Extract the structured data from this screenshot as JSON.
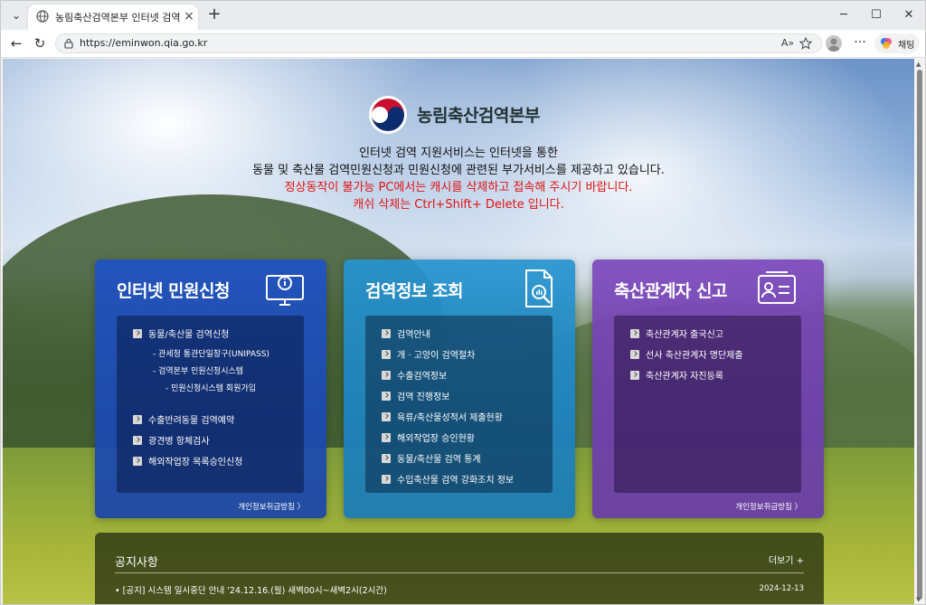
{
  "browser": {
    "tab_title": "농림축산검역본부 인터넷 검역지원",
    "new_tab": "+",
    "url": "https://eminwon.qia.go.kr",
    "copilot_label": "채팅",
    "minimize": "─",
    "maximize": "☐",
    "close": "✕",
    "read_aloud": "A»",
    "more": "···",
    "tab_close": "×",
    "back": "←",
    "refresh": "↻",
    "tab_list": "⌄"
  },
  "header": {
    "brand": "농림축산검역본부",
    "intro_line1": "인터넷 검역 지원서비스는 인터넷을 통한",
    "intro_line2": "동물 및 축산물 검역민원신청과 민원신청에 관련된 부가서비스를 제공하고 있습니다.",
    "warning_line1": "정상동작이 불가능 PC에서는 캐시를 삭제하고 접속해 주시기 바랍니다.",
    "warning_line2": "캐쉬 삭제는 Ctrl+Shift+ Delete 입니다."
  },
  "cards": [
    {
      "title": "인터넷 민원신청",
      "items": [
        "동물/축산물 검역신청",
        "수출반려동물 검역예약",
        "광견병 항체검사",
        "해외작업장 목록승인신청"
      ],
      "subitems": [
        "- 관세청 통관단일창구(UNIPASS)",
        "- 검역본부 민원신청시스템",
        "- 민원신청시스템 회원가입"
      ],
      "privacy": "개인정보취급방침 〉"
    },
    {
      "title": "검역정보 조회",
      "items": [
        "검역안내",
        "개 · 고양이 검역절차",
        "수출검역정보",
        "검역 진행정보",
        "육류/축산물성적서 제출현황",
        "해외작업장 승인현황",
        "동물/축산물 검역 통계",
        "수입축산물 검역 강화조치 정보"
      ]
    },
    {
      "title": "축산관계자 신고",
      "items": [
        "축산관계자 출국신고",
        "선사 축산관계자 명단제출",
        "축산관계자 자진등록"
      ],
      "privacy": "개인정보취급방침 〉"
    }
  ],
  "notice": {
    "title": "공지사항",
    "more": "더보기 +",
    "items": [
      {
        "text": "• [공지] 시스템 일시중단 안내 '24.12.16.(월) 새벽00시~새벽2시(2시간)",
        "date": "2024-12-13"
      }
    ]
  },
  "colors": {
    "card1": "#1f52c4",
    "card2": "#2694d0",
    "card3": "#7c48bc",
    "warning": "#e01212"
  }
}
